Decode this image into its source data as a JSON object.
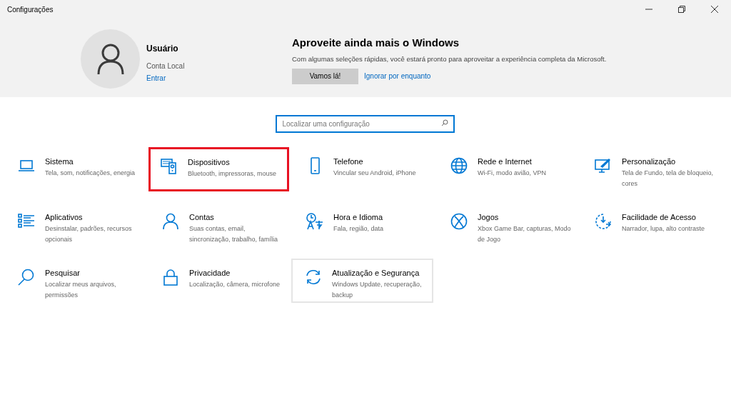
{
  "window": {
    "title": "Configurações"
  },
  "account": {
    "name": "Usuário",
    "type": "Conta Local",
    "link": "Entrar"
  },
  "promo": {
    "title": "Aproveite ainda mais o Windows",
    "text": "Com algumas seleções rápidas, você estará pronto para aproveitar a experiência completa da Microsoft.",
    "primary_button": "Vamos lá!",
    "secondary_link": "Ignorar por enquanto"
  },
  "search": {
    "placeholder": "Localizar uma configuração"
  },
  "categories": [
    {
      "kind": "laptop",
      "title": "Sistema",
      "description": "Tela, som, notificações, energia",
      "highlighted": false,
      "hovered": false
    },
    {
      "kind": "devices",
      "title": "Dispositivos",
      "description": "Bluetooth, impressoras, mouse",
      "highlighted": true,
      "hovered": false
    },
    {
      "kind": "phone",
      "title": "Telefone",
      "description": "Vincular seu Android, iPhone",
      "highlighted": false,
      "hovered": false
    },
    {
      "kind": "globe",
      "title": "Rede e Internet",
      "description": "Wi-Fi, modo avião, VPN",
      "highlighted": false,
      "hovered": false
    },
    {
      "kind": "paint",
      "title": "Personalização",
      "description": "Tela de Fundo, tela de bloqueio, cores",
      "highlighted": false,
      "hovered": false
    },
    {
      "kind": "apps",
      "title": "Aplicativos",
      "description": "Desinstalar, padrões, recursos opcionais",
      "highlighted": false,
      "hovered": false
    },
    {
      "kind": "person",
      "title": "Contas",
      "description": "Suas contas, email, sincronização, trabalho, família",
      "highlighted": false,
      "hovered": false
    },
    {
      "kind": "time",
      "title": "Hora e Idioma",
      "description": "Fala, região, data",
      "highlighted": false,
      "hovered": false
    },
    {
      "kind": "xbox",
      "title": "Jogos",
      "description": "Xbox Game Bar, capturas, Modo de Jogo",
      "highlighted": false,
      "hovered": false
    },
    {
      "kind": "access",
      "title": "Facilidade de Acesso",
      "description": "Narrador, lupa, alto contraste",
      "highlighted": false,
      "hovered": false
    },
    {
      "kind": "search",
      "title": "Pesquisar",
      "description": "Localizar meus arquivos, permissões",
      "highlighted": false,
      "hovered": false
    },
    {
      "kind": "lock",
      "title": "Privacidade",
      "description": "Localização, câmera, microfone",
      "highlighted": false,
      "hovered": false
    },
    {
      "kind": "sync",
      "title": "Atualização e Segurança",
      "description": "Windows Update, recuperação, backup",
      "highlighted": false,
      "hovered": true
    }
  ]
}
